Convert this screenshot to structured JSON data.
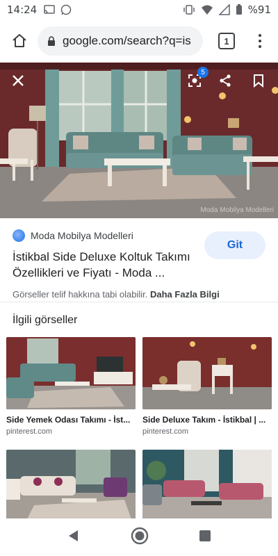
{
  "status_bar": {
    "time": "14:24",
    "battery": "%91"
  },
  "browser": {
    "url": "google.com/search?q=is",
    "tab_count": "1"
  },
  "hero": {
    "lens_badge": "5",
    "watermark": "Moda Mobilya Modelleri"
  },
  "result": {
    "source": "Moda Mobilya Modelleri",
    "title": "İstikbal Side Deluxe Koltuk Takımı Özellikleri ve Fiyatı - Moda ...",
    "visit_label": "Git",
    "copyright_text": "Görseller telif hakkına tabi olabilir.",
    "more_info": "Daha Fazla Bilgi"
  },
  "related": {
    "heading": "İlgili görseller",
    "items": [
      {
        "caption": "Side Yemek Odası Takımı - İst...",
        "source": "pinterest.com"
      },
      {
        "caption": "Side Deluxe Takım - İstikbal | ...",
        "source": "pinterest.com"
      },
      {
        "caption": "",
        "source": ""
      },
      {
        "caption": "",
        "source": ""
      }
    ]
  },
  "colors": {
    "accent": "#1a73e8",
    "button_bg": "#e8f0fe",
    "wall": "#6b2b2b"
  }
}
